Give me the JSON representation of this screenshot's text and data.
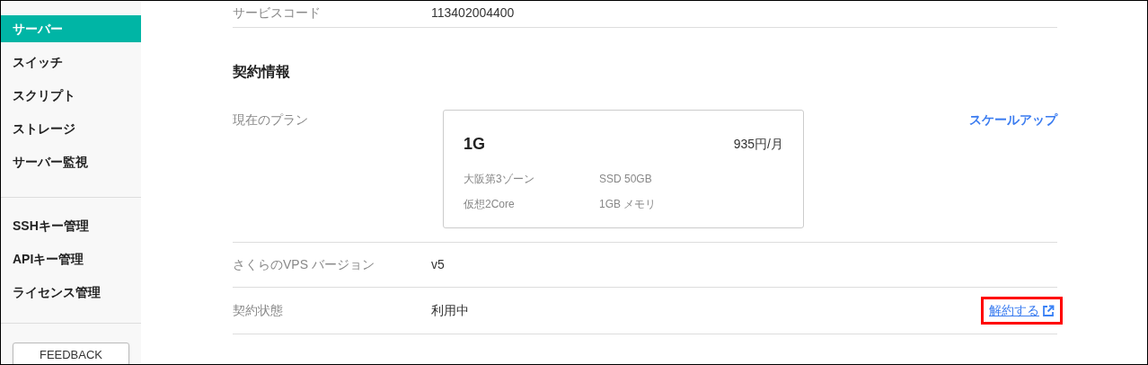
{
  "sidebar": {
    "groups": [
      [
        {
          "label": "サーバー",
          "selected": true
        },
        {
          "label": "スイッチ",
          "selected": false
        },
        {
          "label": "スクリプト",
          "selected": false
        },
        {
          "label": "ストレージ",
          "selected": false
        },
        {
          "label": "サーバー監視",
          "selected": false
        }
      ],
      [
        {
          "label": "SSHキー管理",
          "selected": false
        },
        {
          "label": "APIキー管理",
          "selected": false
        },
        {
          "label": "ライセンス管理",
          "selected": false
        }
      ]
    ],
    "feedback_button": "FEEDBACK"
  },
  "service_code": {
    "label": "サービスコード",
    "value": "113402004400"
  },
  "contract": {
    "heading": "契約情報",
    "plan": {
      "label": "現在のプラン",
      "name": "1G",
      "price": "935円/月",
      "specs": [
        [
          "大阪第3ゾーン",
          "SSD 50GB"
        ],
        [
          "仮想2Core",
          "1GB メモリ"
        ]
      ],
      "action": "スケールアップ"
    },
    "version": {
      "label": "さくらのVPS バージョン",
      "value": "v5"
    },
    "status": {
      "label": "契約状態",
      "value": "利用中",
      "action": "解約する",
      "highlighted": true
    }
  }
}
